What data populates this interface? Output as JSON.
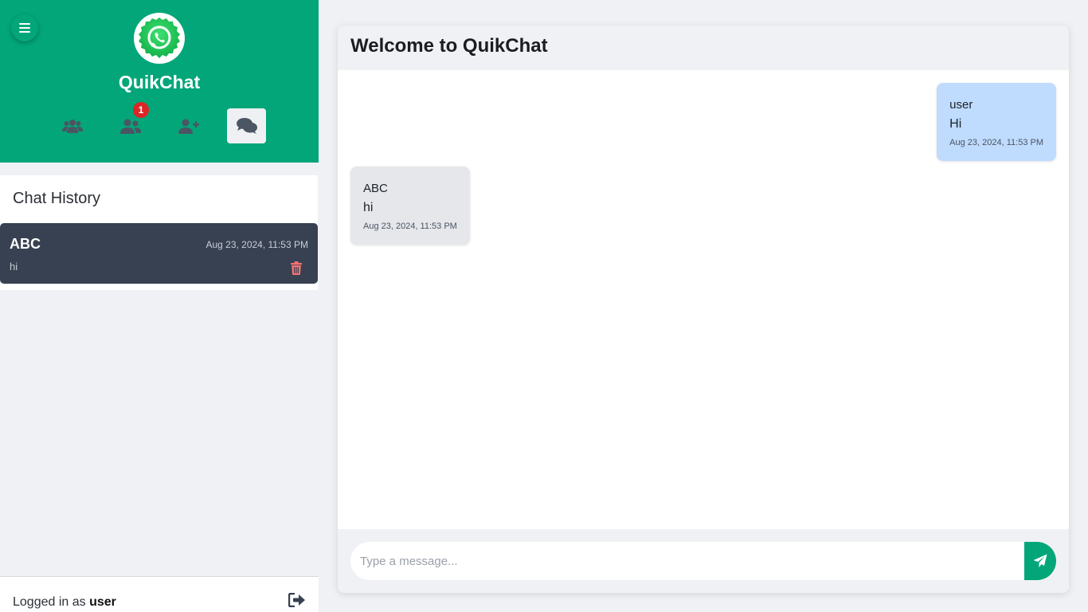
{
  "colors": {
    "brand": "#02a679",
    "active_chat_bg": "#374151",
    "sent_bubble": "#bfdbfe",
    "received_bubble": "#e5e7eb",
    "badge": "#dc2626",
    "delete": "#f87171"
  },
  "sidebar": {
    "app_title": "QuikChat",
    "menu_icon": "hamburger-icon",
    "logo_icon": "whatsapp-logo",
    "nav": [
      {
        "icon": "users-group-icon",
        "active": false
      },
      {
        "icon": "friends-icon",
        "badge": "1",
        "active": false
      },
      {
        "icon": "add-user-icon",
        "active": false
      },
      {
        "icon": "chats-icon",
        "active": true
      }
    ],
    "history": {
      "title": "Chat History",
      "items": [
        {
          "name": "ABC",
          "time": "Aug 23, 2024, 11:53 PM",
          "last_message": "hi",
          "delete_icon": "trash-icon"
        }
      ]
    },
    "footer": {
      "logged_in_prefix": "Logged in as",
      "username": "user",
      "logout_icon": "sign-out-icon"
    }
  },
  "chat": {
    "title": "Welcome to QuikChat",
    "messages": [
      {
        "sender": "user",
        "text": "Hi",
        "time": "Aug 23, 2024, 11:53 PM",
        "direction": "sent"
      },
      {
        "sender": "ABC",
        "text": "hi",
        "time": "Aug 23, 2024, 11:53 PM",
        "direction": "received"
      }
    ],
    "input": {
      "placeholder": "Type a message...",
      "value": ""
    },
    "send_icon": "paper-plane-icon"
  }
}
